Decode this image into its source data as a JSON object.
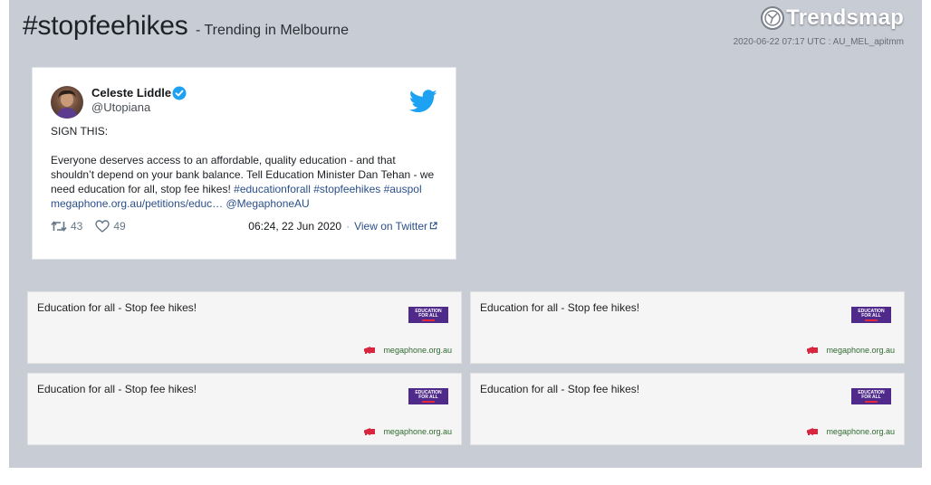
{
  "header": {
    "hashtag": "#stopfeehikes",
    "subtitle": "- Trending in Melbourne",
    "brand": "Trendsmap",
    "meta": "2020-06-22 07:17 UTC : AU_MEL_apitmm"
  },
  "tweet": {
    "author_name": "Celeste Liddle",
    "author_handle": "@Utopiana",
    "verified": true,
    "line1": "SIGN THIS:",
    "body_text": "Everyone deserves access to an affordable, quality education - and that shouldn’t depend on your bank balance. Tell Education Minister Dan Tehan - we need education for all, stop fee hikes!",
    "hashtags": "#educationforall #stopfeehikes #auspol",
    "link_text": "megaphone.org.au/petitions/educ…",
    "mention": "@MegaphoneAU",
    "retweets": "43",
    "likes": "49",
    "timestamp": "06:24, 22 Jun 2020",
    "separator": "·",
    "view_link": "View on Twitter"
  },
  "cards": [
    {
      "title": "Education for all - Stop fee hikes!",
      "domain": "megaphone.org.au",
      "image_text_1": "EDUCATION",
      "image_text_2": "FOR ALL"
    },
    {
      "title": "Education for all - Stop fee hikes!",
      "domain": "megaphone.org.au",
      "image_text_1": "EDUCATION",
      "image_text_2": "FOR ALL"
    },
    {
      "title": "Education for all - Stop fee hikes!",
      "domain": "megaphone.org.au",
      "image_text_1": "EDUCATION",
      "image_text_2": "FOR ALL"
    },
    {
      "title": "Education for all - Stop fee hikes!",
      "domain": "megaphone.org.au",
      "image_text_1": "EDUCATION",
      "image_text_2": "FOR ALL"
    }
  ],
  "colors": {
    "panel_bg": "#c8ccd5",
    "twitter_blue": "#1da1f2",
    "link": "#2b4f8a",
    "card_image": "#4f2a8a",
    "megaphone_red": "#d7263d"
  },
  "icons": [
    "trendsmap-logo-icon",
    "verified-icon",
    "twitter-bird-icon",
    "retweet-icon",
    "heart-icon",
    "external-link-icon",
    "megaphone-icon"
  ]
}
